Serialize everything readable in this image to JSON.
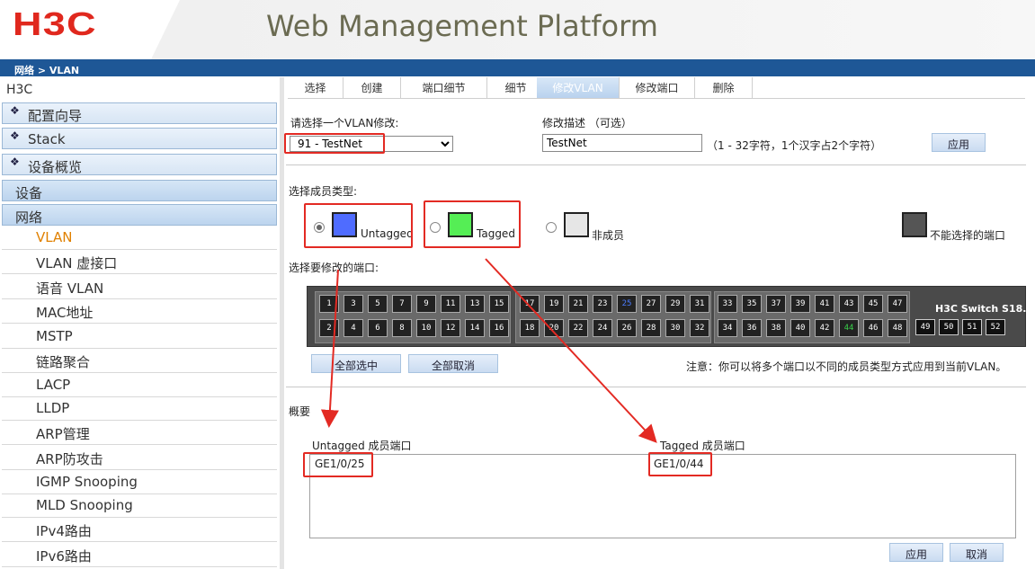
{
  "header": {
    "logo": "H3C",
    "title": "Web Management Platform"
  },
  "breadcrumb": "网络 > VLAN",
  "sidebar": {
    "root": "H3C",
    "groups": [
      {
        "label": "配置向导",
        "icon": "diamond-icon"
      },
      {
        "label": "Stack",
        "icon": "diamond-icon"
      },
      {
        "label": "设备概览",
        "icon": "diamond-icon"
      }
    ],
    "sections": [
      "设备",
      "网络"
    ],
    "items": [
      "VLAN",
      "VLAN 虚接口",
      "语音 VLAN",
      "MAC地址",
      "MSTP",
      "链路聚合",
      "LACP",
      "LLDP",
      "ARP管理",
      "ARP防攻击",
      "IGMP Snooping",
      "MLD Snooping",
      "IPv4路由",
      "IPv6路由"
    ],
    "active_item": "VLAN"
  },
  "tabs": [
    "选择",
    "创建",
    "端口细节",
    "细节",
    "修改VLAN",
    "修改端口",
    "删除"
  ],
  "active_tab": "修改VLAN",
  "form": {
    "select_vlan_label": "请选择一个VLAN修改:",
    "select_vlan_value": "91 - TestNet",
    "desc_label": "修改描述 （可选）",
    "desc_value": "TestNet",
    "desc_hint": "（1 - 32字符，1个汉字占2个字符）",
    "apply_top": "应用"
  },
  "member_type": {
    "label": "选择成员类型:",
    "options": [
      {
        "label": "Untagged",
        "color": "#4f6cff",
        "checked": true
      },
      {
        "label": "Tagged",
        "color": "#55ee55",
        "checked": false
      },
      {
        "label": "非成员",
        "color": "#e6e6e6",
        "checked": false
      }
    ],
    "unselectable_label": "不能选择的端口",
    "unselectable_color": "#555555"
  },
  "ports": {
    "label": "选择要修改的端口:",
    "top_row": [
      "1",
      "3",
      "5",
      "7",
      "9",
      "11",
      "13",
      "15",
      "17",
      "19",
      "21",
      "23",
      "25",
      "27",
      "29",
      "31",
      "33",
      "35",
      "37",
      "39",
      "41",
      "43",
      "45",
      "47"
    ],
    "bottom_row": [
      "2",
      "4",
      "6",
      "8",
      "10",
      "12",
      "14",
      "16",
      "18",
      "20",
      "22",
      "24",
      "26",
      "28",
      "30",
      "32",
      "34",
      "36",
      "38",
      "40",
      "42",
      "44",
      "46",
      "48"
    ],
    "sfp": [
      "49",
      "50",
      "51",
      "52"
    ],
    "untagged_port": "25",
    "tagged_port": "44",
    "switch_name": "H3C Switch S18...",
    "select_all": "全部选中",
    "cancel_all": "全部取消",
    "note": "注意：你可以将多个端口以不同的成员类型方式应用到当前VLAN。"
  },
  "summary": {
    "label": "概要",
    "untagged_header": "Untagged 成员端口",
    "untagged_value": "GE1/0/25",
    "tagged_header": "Tagged 成员端口",
    "tagged_value": "GE1/0/44"
  },
  "footer": {
    "apply": "应用",
    "cancel": "取消"
  },
  "colors": {
    "brand_red": "#e0281e",
    "header_blue": "#1e5796",
    "annotation_red": "#e32a23"
  }
}
